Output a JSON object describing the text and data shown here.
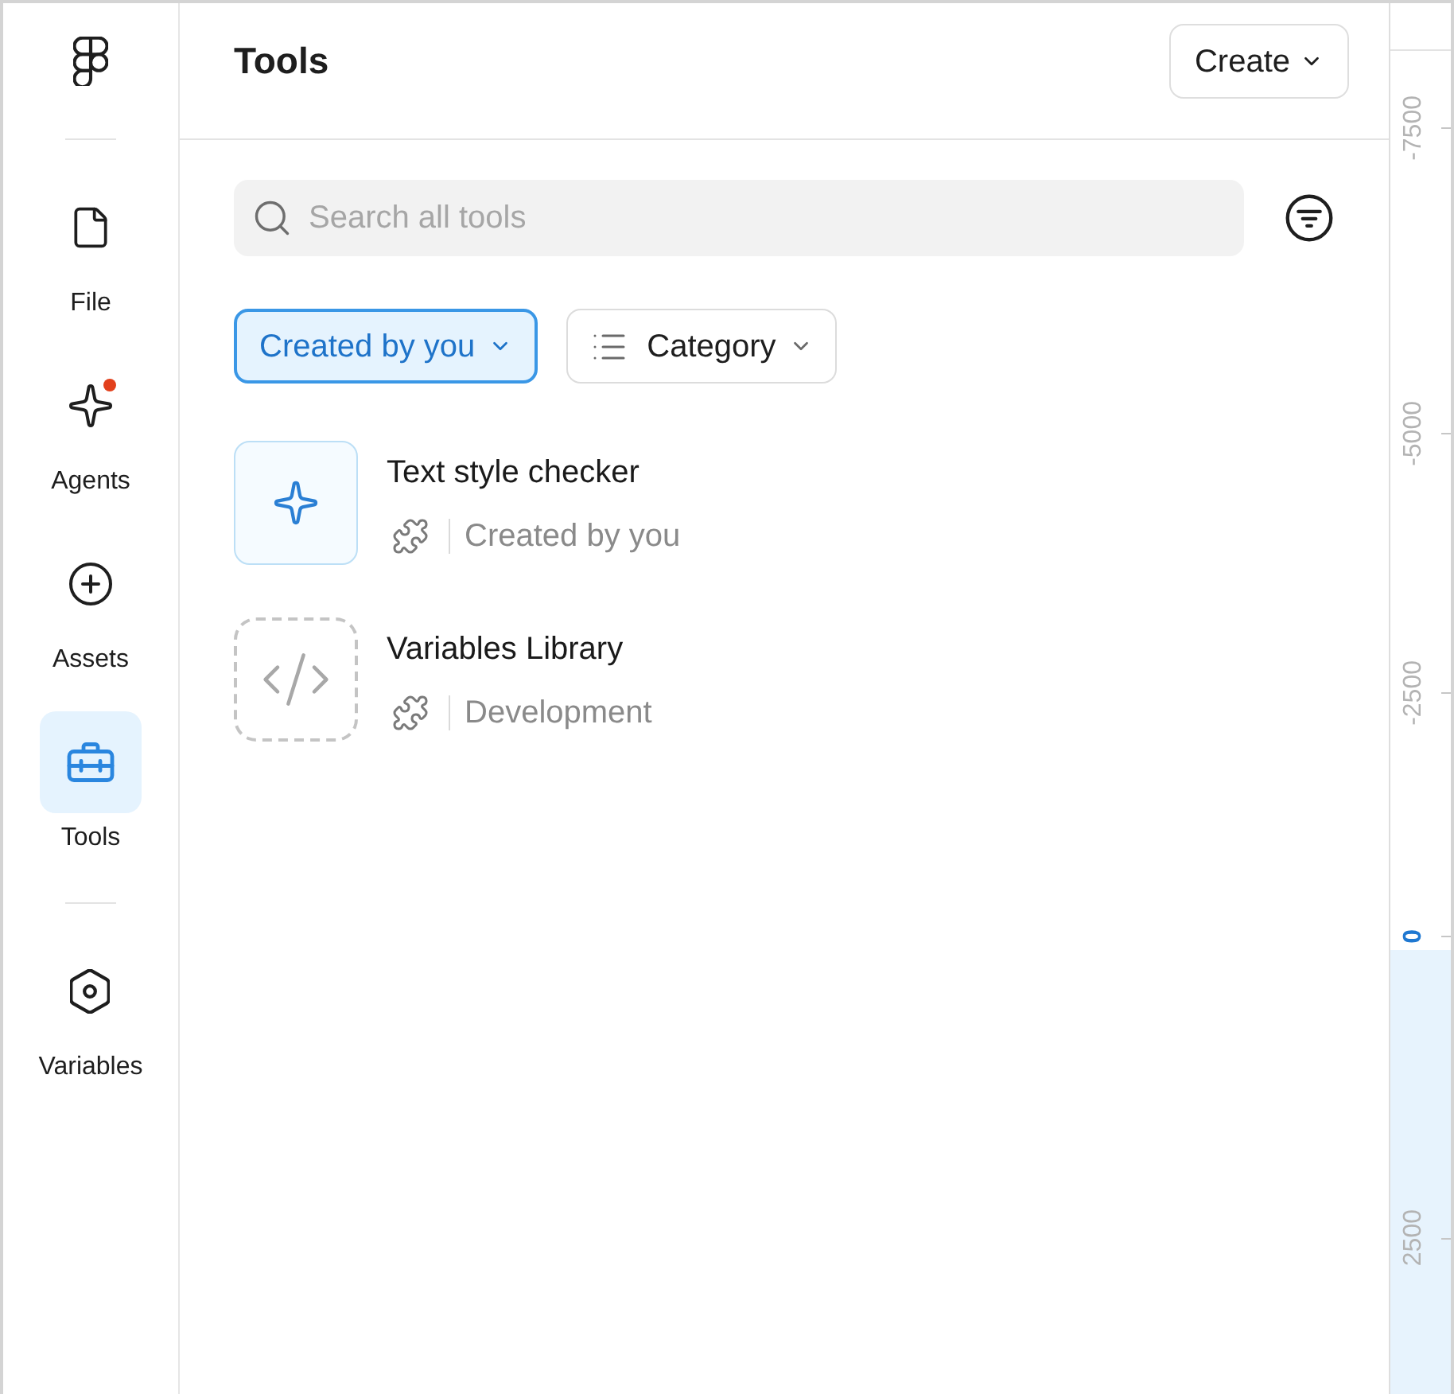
{
  "sidebar": {
    "groups": [
      {
        "items": [
          {
            "kind": "file",
            "label": "File",
            "selected": false,
            "notification": false
          },
          {
            "kind": "agents",
            "label": "Agents",
            "selected": false,
            "notification": true
          },
          {
            "kind": "assets",
            "label": "Assets",
            "selected": false,
            "notification": false
          },
          {
            "kind": "tools",
            "label": "Tools",
            "selected": true,
            "notification": false
          }
        ]
      },
      {
        "items": [
          {
            "kind": "variables",
            "label": "Variables",
            "selected": false,
            "notification": false
          }
        ]
      }
    ]
  },
  "panel": {
    "title": "Tools",
    "create_button": "Create",
    "search": {
      "placeholder": "Search all tools"
    },
    "filters": [
      {
        "kind": "owner",
        "label": "Created by you",
        "selected": true
      },
      {
        "kind": "category",
        "label": "Category",
        "selected": false
      }
    ],
    "tools": [
      {
        "kind": "agent",
        "name": "Text style checker",
        "category": "Created by you"
      },
      {
        "kind": "development",
        "name": "Variables Library",
        "category": "Development"
      }
    ]
  },
  "ruler": {
    "marks": [
      {
        "label": "-7500",
        "highlighted": false
      },
      {
        "label": "-5000",
        "highlighted": false
      },
      {
        "label": "-2500",
        "highlighted": false
      },
      {
        "label": "0",
        "highlighted": true
      },
      {
        "label": "2500",
        "highlighted": false
      }
    ]
  }
}
